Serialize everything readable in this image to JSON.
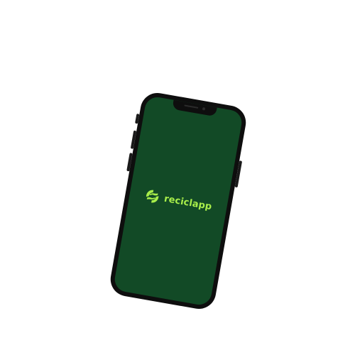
{
  "app": {
    "name": "reciclapp",
    "logo_icon": "recycle-hands-icon"
  },
  "colors": {
    "screen_background": "#124a26",
    "brand_accent": "#a8ee4a",
    "phone_frame": "#0e0e0e"
  }
}
